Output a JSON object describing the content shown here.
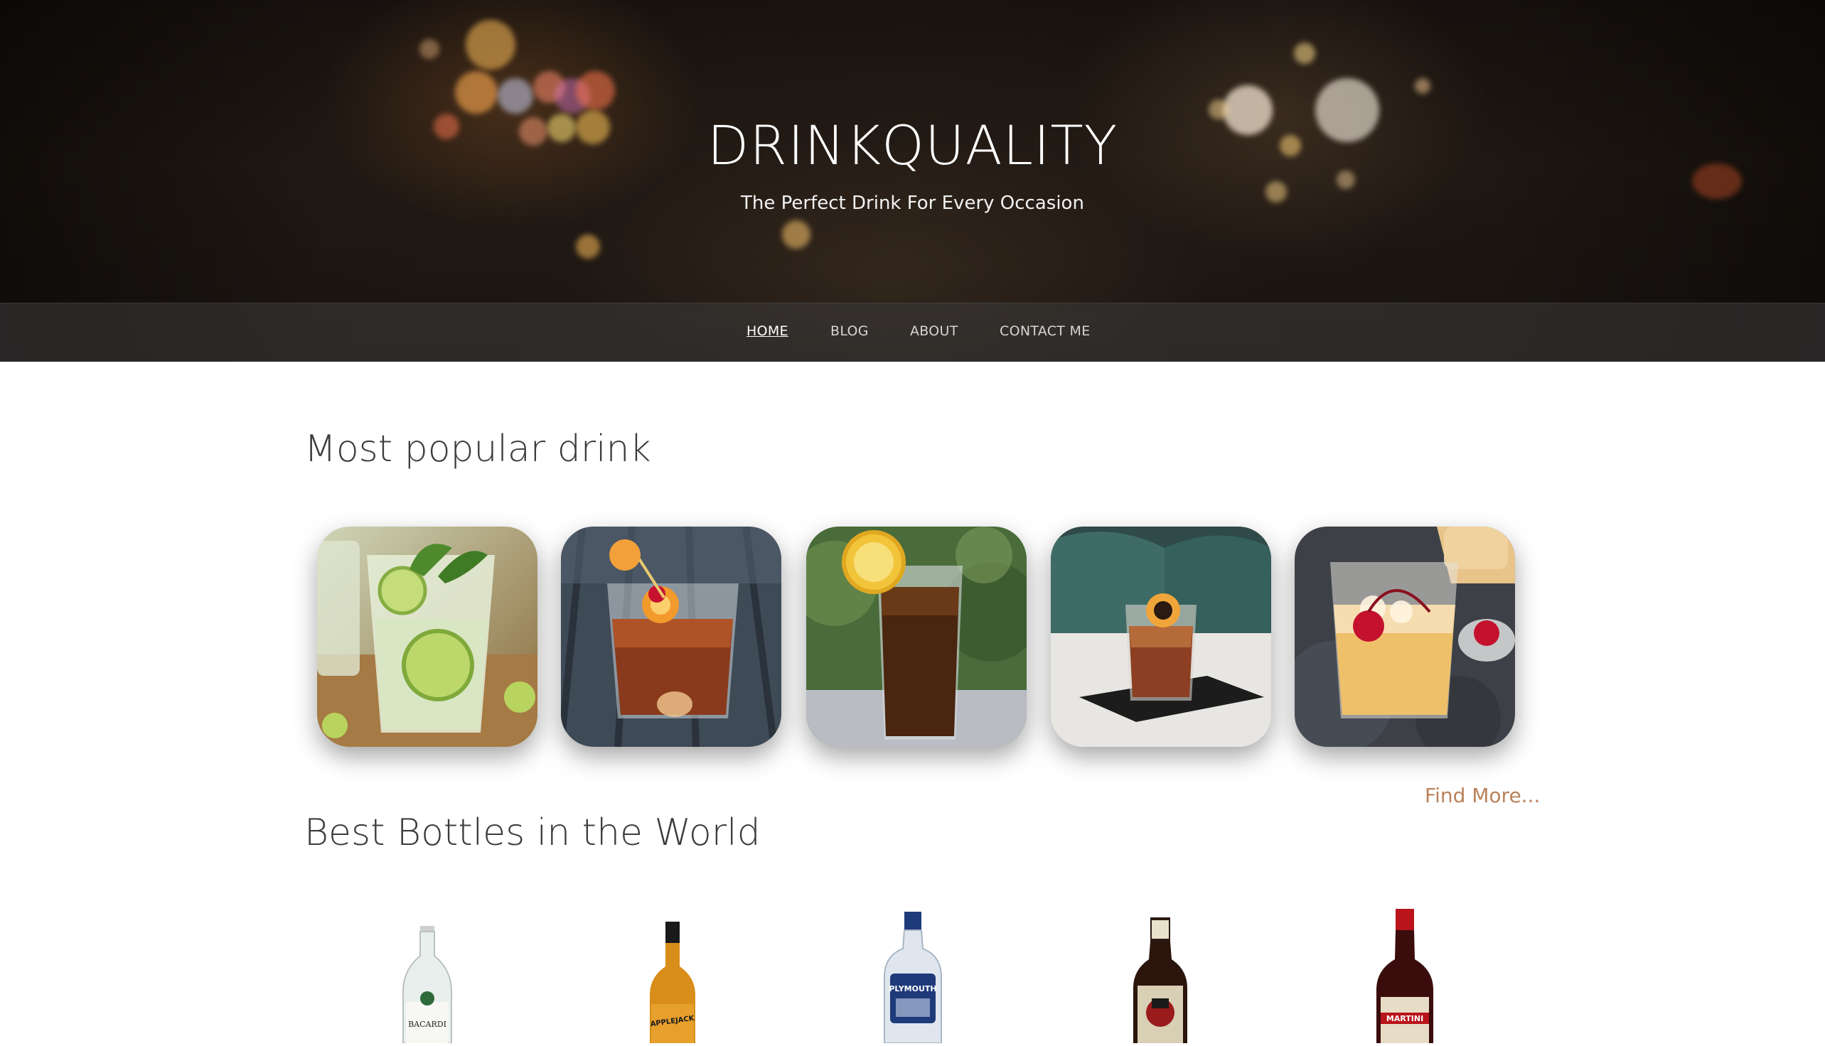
{
  "hero": {
    "title": "DRINKQUALITY",
    "subtitle": "The Perfect Drink For Every Occasion"
  },
  "nav": {
    "items": [
      {
        "label": "HOME",
        "active": true
      },
      {
        "label": "BLOG",
        "active": false
      },
      {
        "label": "ABOUT",
        "active": false
      },
      {
        "label": "CONTACT ME",
        "active": false
      }
    ]
  },
  "popular": {
    "title": "Most popular drink",
    "find_more": "Find More...",
    "drinks": [
      {
        "image": "mojito-photo"
      },
      {
        "image": "old-fashioned-photo"
      },
      {
        "image": "cola-highball-photo"
      },
      {
        "image": "whiskey-cocktail-photo"
      },
      {
        "image": "whiskey-sour-photo"
      }
    ]
  },
  "bottles": {
    "title": "Best Bottles in the World",
    "items": [
      {
        "image": "bacardi-bottle",
        "label": "BACARDI"
      },
      {
        "image": "lairds-applejack-bottle",
        "label": "APPLEJACK"
      },
      {
        "image": "plymouth-gin-bottle",
        "label": "PLYMOUTH"
      },
      {
        "image": "captain-morgan-bottle",
        "label": ""
      },
      {
        "image": "martini-bottle",
        "label": "MARTINI"
      }
    ]
  },
  "colors": {
    "accent_link": "#b9825a",
    "heading": "#3c3c3c",
    "nav_bg": "#3c3c3c"
  }
}
